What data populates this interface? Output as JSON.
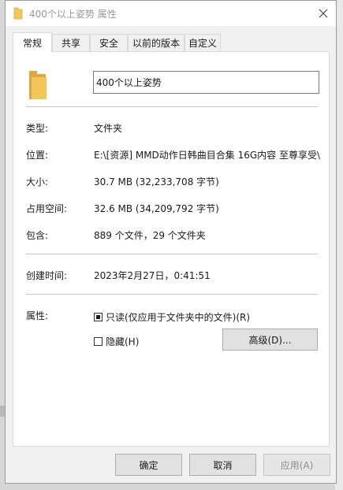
{
  "window": {
    "title": "400个以上姿势 属性"
  },
  "tabs": [
    {
      "label": "常规"
    },
    {
      "label": "共享"
    },
    {
      "label": "安全"
    },
    {
      "label": "以前的版本"
    },
    {
      "label": "自定义"
    }
  ],
  "general": {
    "name": "400个以上姿势",
    "rows": [
      {
        "label": "类型:",
        "value": "文件夹"
      },
      {
        "label": "位置:",
        "value": "E:\\[资源] MMD动作日韩曲目合集 16G内容 至尊享受\\"
      },
      {
        "label": "大小:",
        "value": "30.7 MB (32,233,708 字节)"
      },
      {
        "label": "占用空间:",
        "value": "32.6 MB (34,209,792 字节)"
      },
      {
        "label": "包含:",
        "value": "889 个文件，29 个文件夹"
      },
      {
        "label": "创建时间:",
        "value": "2023年2月27日，0:41:51"
      }
    ],
    "attributes": {
      "label": "属性:",
      "readonly": "只读(仅应用于文件夹中的文件)(R)",
      "hidden": "隐藏(H)",
      "advanced": "高级(D)..."
    }
  },
  "footer": {
    "ok": "确定",
    "cancel": "取消",
    "apply": "应用(A)"
  },
  "colors": {
    "folder": "#f3c65a",
    "folder_dark": "#e0a83a",
    "panel": "#ffffff",
    "dialog": "#f0f0f0"
  },
  "icons": {
    "title": "folder-icon",
    "close": "close-icon",
    "large": "folder-icon"
  }
}
